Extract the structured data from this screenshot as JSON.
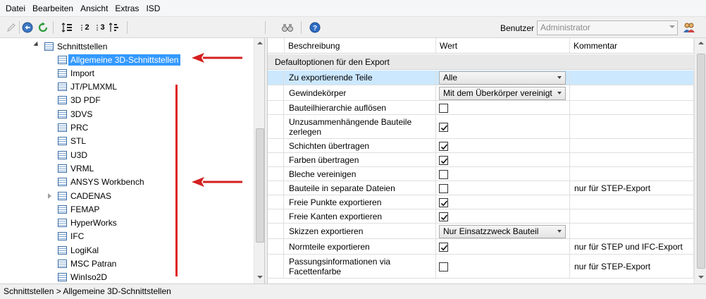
{
  "menu": [
    "Datei",
    "Bearbeiten",
    "Ansicht",
    "Extras",
    "ISD"
  ],
  "toolbar": {
    "user_label": "Benutzer",
    "user_value": "Administrator",
    "icons": [
      "pencil-icon",
      "back-icon",
      "refresh-icon",
      "sort-icon",
      "level-2-icon",
      "level-3-icon",
      "filter-icon",
      "binoculars-icon",
      "help-icon",
      "users-icon"
    ],
    "level2": "2",
    "level3": "3"
  },
  "tree": {
    "root": "Schnittstellen",
    "items": [
      "Allgemeine 3D-Schnittstellen",
      "Import",
      "JT/PLMXML",
      "3D PDF",
      "3DVS",
      "PRC",
      "STL",
      "U3D",
      "VRML",
      "ANSYS Workbench",
      "CADENAS",
      "FEMAP",
      "HyperWorks",
      "IFC",
      "LogiKal",
      "MSC Patran",
      "WinIso2D"
    ],
    "selected_index": 0,
    "collapsed_index": 10
  },
  "grid": {
    "columns": [
      "Beschreibung",
      "Wert",
      "Kommentar"
    ],
    "group": "Defaultoptionen für den Export",
    "rows": [
      {
        "desc": "Zu exportierende Teile",
        "type": "combo",
        "value": "Alle",
        "comment": ""
      },
      {
        "desc": "Gewindekörper",
        "type": "combo",
        "value": "Mit dem Überkörper vereinigt",
        "comment": ""
      },
      {
        "desc": "Bauteilhierarchie auflösen",
        "type": "check",
        "checked": false,
        "comment": ""
      },
      {
        "desc": "Unzusammenhängende Bauteile zerlegen",
        "type": "check",
        "checked": true,
        "comment": ""
      },
      {
        "desc": "Schichten übertragen",
        "type": "check",
        "checked": true,
        "comment": ""
      },
      {
        "desc": "Farben übertragen",
        "type": "check",
        "checked": true,
        "comment": ""
      },
      {
        "desc": "Bleche vereinigen",
        "type": "check",
        "checked": false,
        "comment": ""
      },
      {
        "desc": "Bauteile in separate Dateien",
        "type": "check",
        "checked": false,
        "comment": "nur für STEP-Export"
      },
      {
        "desc": "Freie Punkte exportieren",
        "type": "check",
        "checked": true,
        "comment": ""
      },
      {
        "desc": "Freie Kanten exportieren",
        "type": "check",
        "checked": true,
        "comment": ""
      },
      {
        "desc": "Skizzen exportieren",
        "type": "combo",
        "value": "Nur Einsatzzweck Bauteil",
        "comment": ""
      },
      {
        "desc": "Normteile exportieren",
        "type": "check",
        "checked": true,
        "comment": "nur für STEP und IFC-Export"
      },
      {
        "desc": "Passungsinformationen via Facettenfarbe",
        "type": "check",
        "checked": false,
        "comment": "nur für STEP-Export"
      }
    ]
  },
  "status": {
    "path": "Schnittstellen > Allgemeine 3D-Schnittstellen"
  },
  "colors": {
    "selection": "#3399ff",
    "row_highlight": "#cce8ff",
    "annotation": "#e02020"
  }
}
